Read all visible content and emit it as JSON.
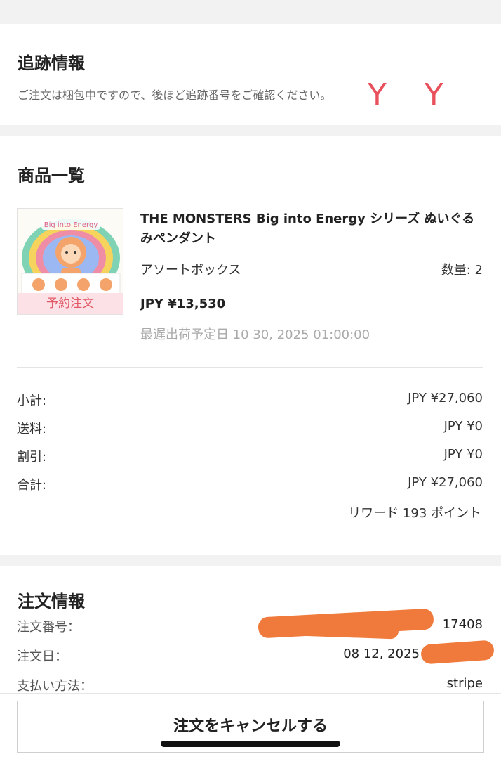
{
  "tracking": {
    "title": "追跡情報",
    "message": "ご注文は梱包中ですので、後ほど追跡番号をご確認ください。",
    "annotation": "Y Y"
  },
  "products": {
    "title": "商品一覧",
    "item": {
      "name": "THE MONSTERS Big into Energy シリーズ ぬいぐるみペンダント",
      "badge": "予約注文",
      "thumb_text": "Big into Energy",
      "variant": "アソートボックス",
      "quantity": "数量: 2",
      "price": "JPY ¥13,530",
      "ship_date": "最遅出荷予定日 10 30, 2025 01:00:00"
    },
    "summary": [
      {
        "label": "小計:",
        "value": "JPY ¥27,060"
      },
      {
        "label": "送料:",
        "value": "JPY ¥0"
      },
      {
        "label": "割引:",
        "value": "JPY ¥0"
      },
      {
        "label": "合計:",
        "value": "JPY ¥27,060"
      }
    ],
    "reward": "リワード 193 ポイント"
  },
  "order": {
    "title": "注文情報",
    "rows": [
      {
        "label": "注文番号：",
        "value": "17408"
      },
      {
        "label": "注文日：",
        "value": "08 12, 2025"
      },
      {
        "label": "支払い方法：",
        "value": "stripe"
      }
    ]
  },
  "actions": {
    "cancel_label": "注文をキャンセルする"
  },
  "colors": {
    "background": "#f2f2f2",
    "card": "#ffffff",
    "badge_bg": "#fce2e6",
    "badge_text": "#e15a68",
    "redaction": "#f07a3c"
  }
}
